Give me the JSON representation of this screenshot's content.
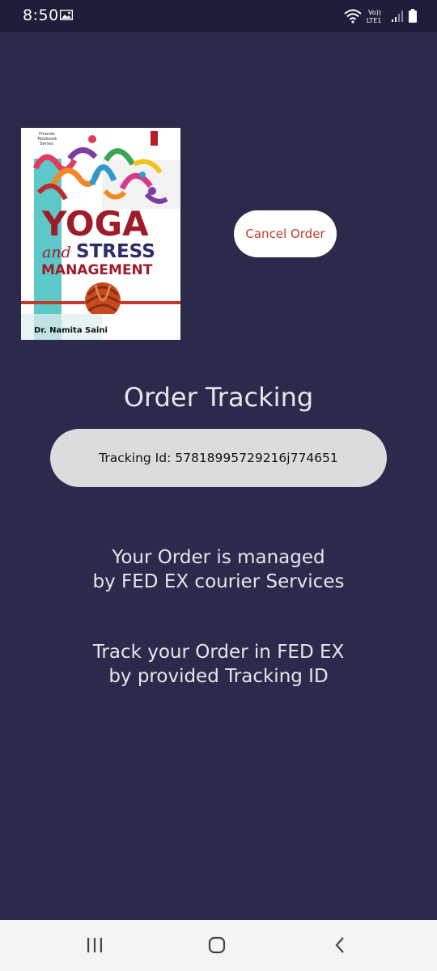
{
  "status_bar": {
    "time": "8:50",
    "network_label_top": "Vo))",
    "network_label_bottom": "LTE1"
  },
  "book": {
    "series_line1": "Friends",
    "series_line2": "Textbook",
    "series_line3": "Series",
    "title_word1": "YOGA",
    "title_word2": "and",
    "title_word3": "STRESS",
    "title_word4": "MANAGEMENT",
    "author": "Dr. Namita Saini"
  },
  "actions": {
    "cancel_label": "Cancel Order"
  },
  "page": {
    "title": "Order Tracking",
    "tracking_text": "Tracking Id: 57818995729216j774651",
    "info_1_line1": "Your Order is managed",
    "info_1_line2": "by FED EX courier Services",
    "info_2_line1": "Track your Order in FED EX",
    "info_2_line2": "by provided Tracking ID"
  },
  "nav": {
    "recent_icon": "recent-apps-icon",
    "home_icon": "home-icon",
    "back_icon": "back-icon"
  },
  "colors": {
    "background": "#2b2a4c",
    "status_bar": "#1f1e38",
    "cancel_text": "#c0392b",
    "pill": "#dcdcde",
    "cover_title_red": "#9e1b2a",
    "cover_teal": "#5cc8c8"
  }
}
